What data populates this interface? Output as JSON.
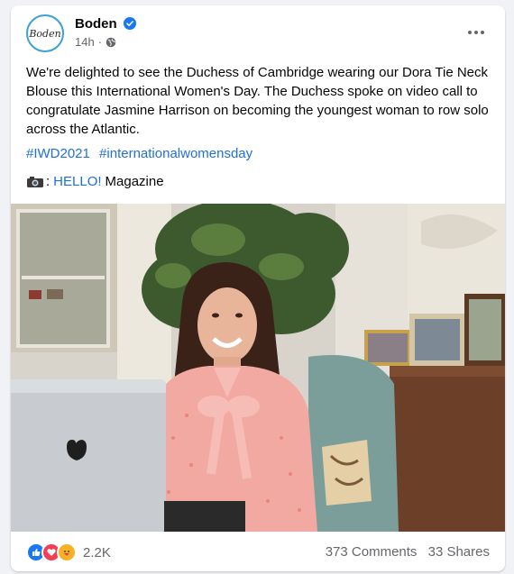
{
  "post": {
    "page_name": "Boden",
    "avatar_text": "Boden",
    "time": "14h",
    "dot": "·",
    "text": "We're delighted to see the Duchess of Cambridge wearing our Dora Tie Neck Blouse this International Women's Day. The Duchess spoke on video call to congratulate Jasmine Harrison on becoming the youngest woman to row solo across the Atlantic.",
    "hashtags": [
      "#IWD2021",
      "#internationalwomensday"
    ],
    "credit_prefix": ":",
    "credit_link": "HELLO!",
    "credit_suffix": "Magazine"
  },
  "footer": {
    "reactions": [
      "like",
      "love",
      "care"
    ],
    "reaction_count": "2.2K",
    "comments": "373 Comments",
    "shares": "33 Shares"
  },
  "colors": {
    "link": "#216fdb",
    "verified": "#1877f2",
    "secondary_text": "#65676b"
  },
  "icons": [
    "verified-badge-icon",
    "globe-icon",
    "more-options-icon",
    "camera-icon",
    "like-reaction-icon",
    "love-reaction-icon",
    "care-reaction-icon"
  ]
}
